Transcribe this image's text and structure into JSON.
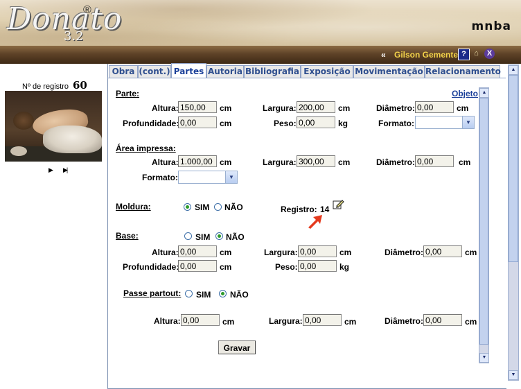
{
  "header": {
    "logo_text": "Donato",
    "logo_registered": "®",
    "logo_version": "3.2",
    "brand": "mnba",
    "breadcrumb_sep": "«",
    "user_name": "Gilson Gemente",
    "help_icon": "?",
    "close_icon": "X"
  },
  "left": {
    "registro_label": "Nº de registro",
    "registro_value": "60",
    "nav_play": "▶",
    "nav_end": "▶|"
  },
  "tabs": [
    {
      "label": "Obra"
    },
    {
      "label": "(cont.)"
    },
    {
      "label": "Partes",
      "active": true
    },
    {
      "label": "Autoria"
    },
    {
      "label": "Bibliografia"
    },
    {
      "label": "Exposição"
    },
    {
      "label": "Movimentação"
    },
    {
      "label": "Relacionamento"
    }
  ],
  "parte": {
    "title": "Parte:",
    "link": "Objeto",
    "altura_label": "Altura:",
    "altura_value": "150,00",
    "altura_unit": "cm",
    "largura_label": "Largura:",
    "largura_value": "200,00",
    "largura_unit": "cm",
    "diametro_label": "Diâmetro:",
    "diametro_value": "0,00",
    "diametro_unit": "cm",
    "profundidade_label": "Profundidade:",
    "profundidade_value": "0,00",
    "profundidade_unit": "cm",
    "peso_label": "Peso:",
    "peso_value": "0,00",
    "peso_unit": "kg",
    "formato_label": "Formato:",
    "formato_value": ""
  },
  "area": {
    "title": "Área impressa:",
    "altura_label": "Altura:",
    "altura_value": "1.000,00",
    "altura_unit": "cm",
    "largura_label": "Largura:",
    "largura_value": "300,00",
    "largura_unit": "cm",
    "diametro_label": "Diâmetro:",
    "diametro_value": "0,00",
    "diametro_unit": "cm",
    "formato_label": "Formato:",
    "formato_value": ""
  },
  "moldura": {
    "title": "Moldura:",
    "sim": "SIM",
    "nao": "NÃO",
    "selected": "SIM",
    "registro_label": "Registro:",
    "registro_value": "14"
  },
  "base": {
    "title": "Base:",
    "sim": "SIM",
    "nao": "NÃO",
    "selected": "NÃO",
    "altura_label": "Altura:",
    "altura_value": "0,00",
    "altura_unit": "cm",
    "largura_label": "Largura:",
    "largura_value": "0,00",
    "largura_unit": "cm",
    "diametro_label": "Diâmetro:",
    "diametro_value": "0,00",
    "diametro_unit": "cm",
    "profundidade_label": "Profundidade:",
    "profundidade_value": "0,00",
    "profundidade_unit": "cm",
    "peso_label": "Peso:",
    "peso_value": "0,00",
    "peso_unit": "kg"
  },
  "passe": {
    "title": "Passe partout:",
    "sim": "SIM",
    "nao": "NÃO",
    "selected": "NÃO",
    "altura_label": "Altura:",
    "altura_value": "0,00",
    "altura_unit": "cm",
    "largura_label": "Largura:",
    "largura_value": "0,00",
    "largura_unit": "cm",
    "diametro_label": "Diâmetro:",
    "diametro_value": "0,00",
    "diametro_unit": "cm"
  },
  "actions": {
    "save_label": "Gravar"
  },
  "colors": {
    "accent_link": "#1a3f99",
    "user_name": "#f3d34a",
    "arrow": "#e53a1e",
    "radio_dot": "#2c9a2c"
  }
}
